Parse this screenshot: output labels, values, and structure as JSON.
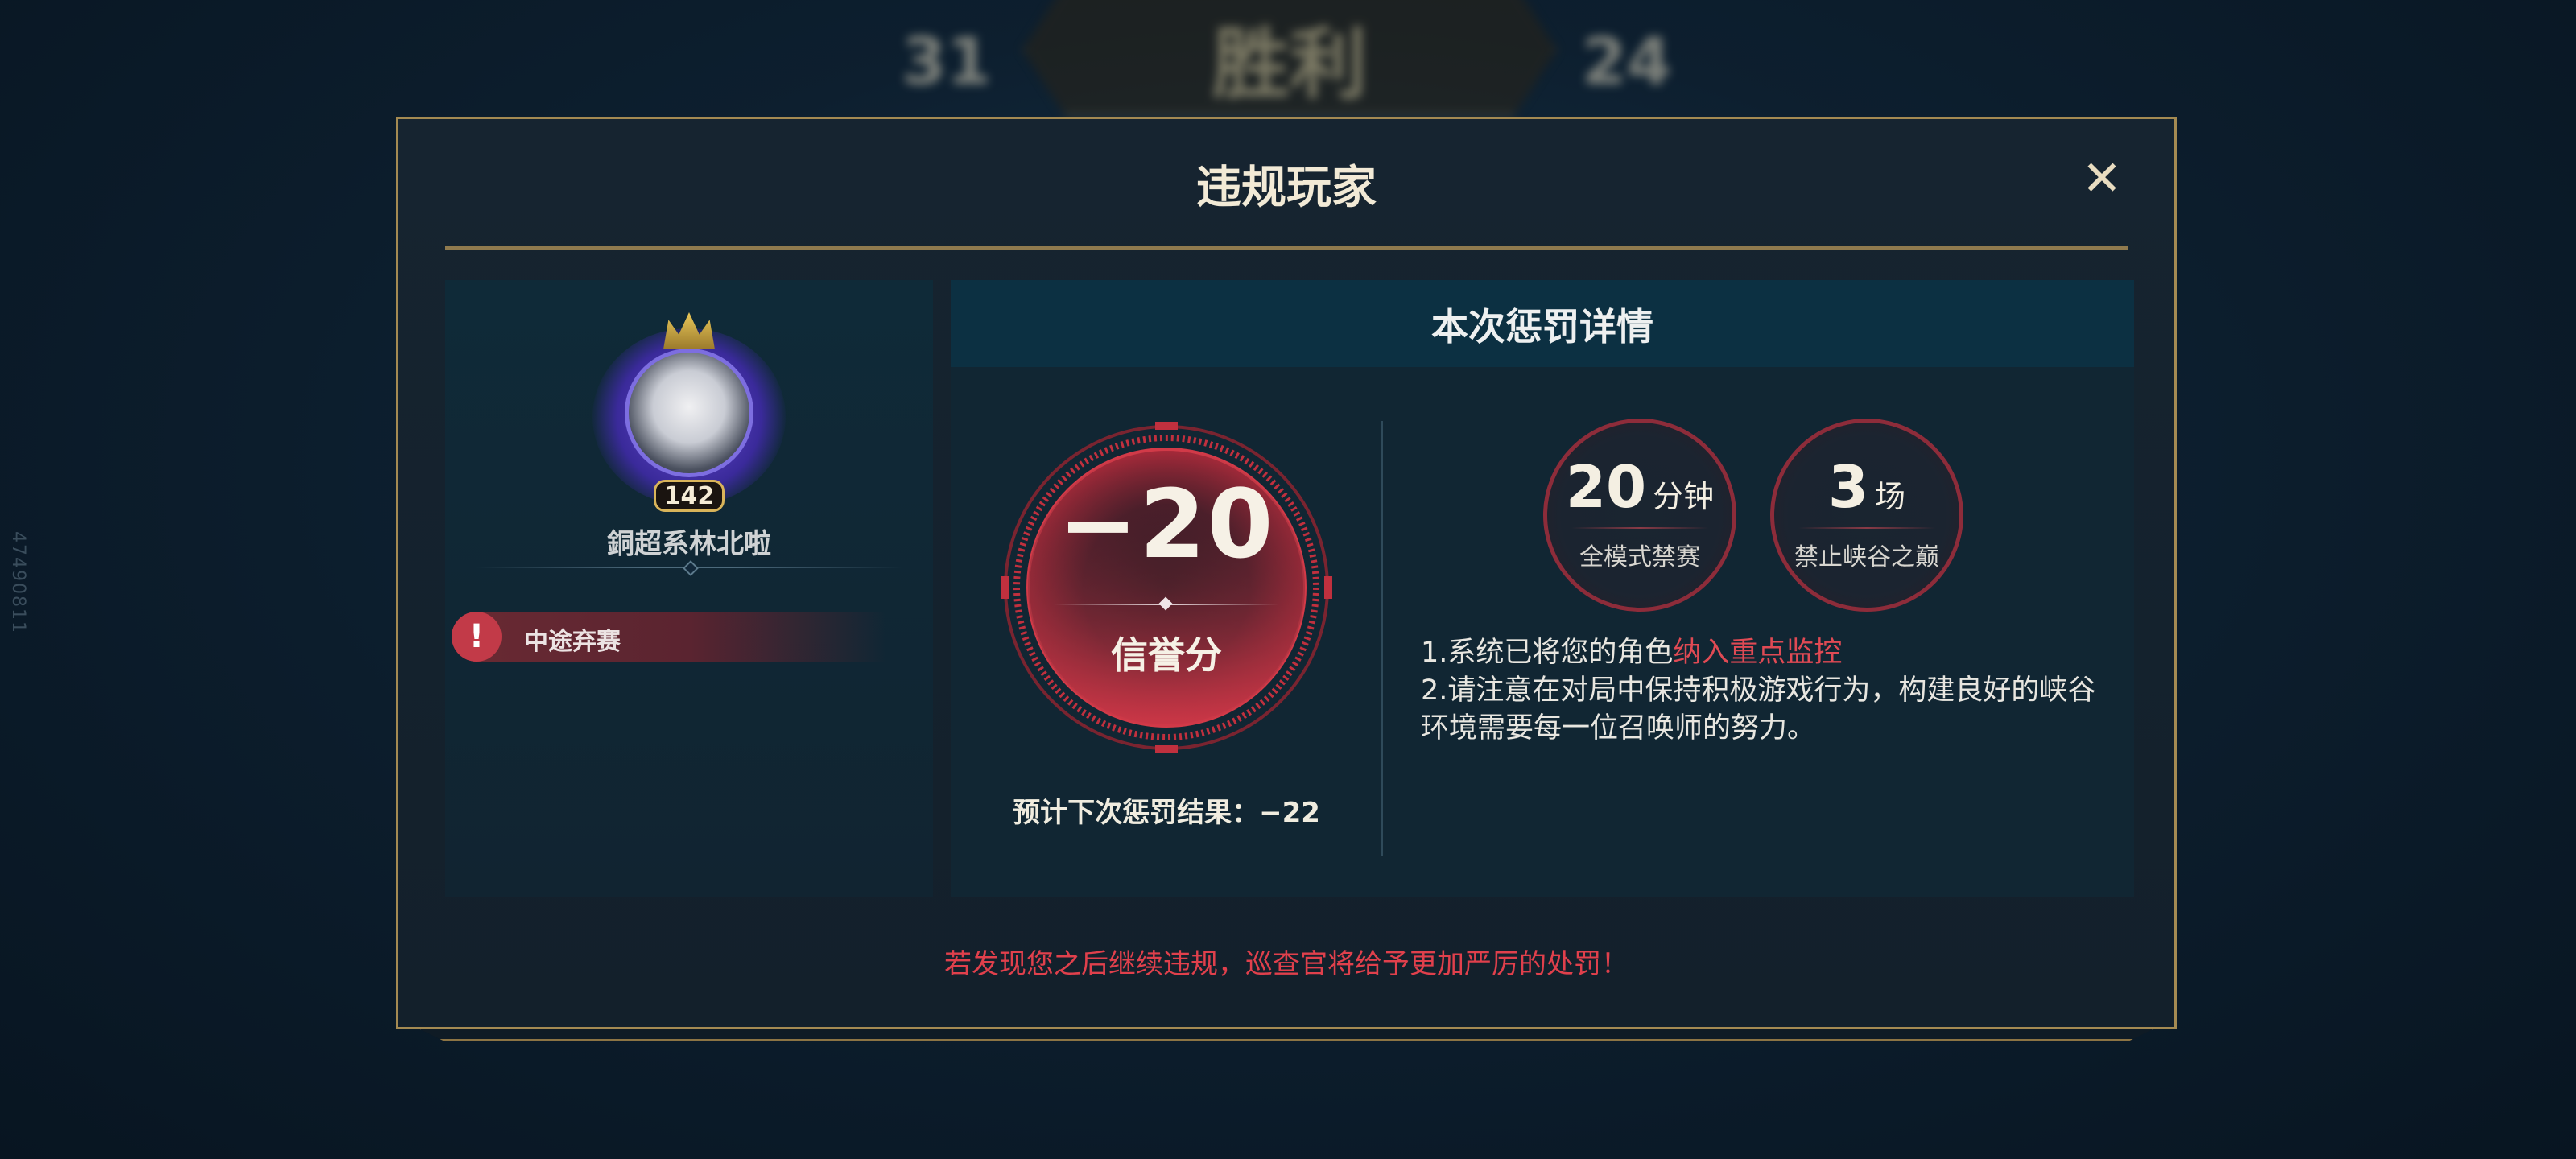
{
  "background": {
    "score_left": "31",
    "result_text": "胜利",
    "score_right": "24",
    "side_id": "47490811"
  },
  "dialog": {
    "title": "违规玩家",
    "close_symbol": "✕"
  },
  "player": {
    "level": "142",
    "name": "銅超系林北啦",
    "violation": "中途弃赛",
    "violation_icon": "!"
  },
  "details": {
    "header": "本次惩罚详情",
    "score_change": "−20",
    "score_label": "信誉分",
    "next_penalty": "预计下次惩罚结果：−22",
    "stats": [
      {
        "num": "20",
        "unit": "分钟",
        "label": "全模式禁赛"
      },
      {
        "num": "3",
        "unit": "场",
        "label": "禁止峡谷之巅"
      }
    ],
    "note1_prefix": "1.系统已将您的角色",
    "note1_highlight": "纳入重点监控",
    "note2": "2.请注意在对局中保持积极游戏行为，构建良好的峡谷环境需要每一位召唤师的努力。"
  },
  "footer": {
    "warning": "若发现您之后继续违规，巡查官将给予更加严厉的处罚！"
  },
  "colors": {
    "accent_gold": "#a48a52",
    "alert_red": "#e0404c",
    "ring_red": "#c0303e"
  }
}
